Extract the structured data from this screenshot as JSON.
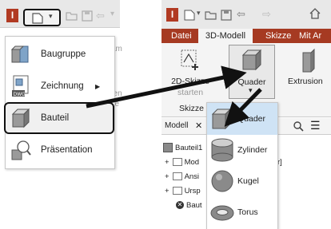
{
  "left_window": {
    "app_letter": "I",
    "bg_labels": [
      "sam",
      "nen",
      "ue"
    ],
    "menu": [
      {
        "label": "Baugruppe",
        "icon": "assembly-icon"
      },
      {
        "label": "Zeichnung",
        "icon": "drawing-icon",
        "submenu": true,
        "badge": "DWG"
      },
      {
        "label": "Bauteil",
        "icon": "part-icon",
        "highlighted": true
      },
      {
        "label": "Präsentation",
        "icon": "presentation-icon"
      }
    ]
  },
  "right_window": {
    "app_letter": "I",
    "tabs": [
      "Datei",
      "3D-Modell",
      "Skizze",
      "Mit Ar"
    ],
    "active_tab": "3D-Modell",
    "ribbon": {
      "sketch_button": "2D-Skizze",
      "sketch_sub": "starten",
      "primitive_button": "Quader",
      "extrude_button": "Extrusion",
      "group_label": "Skizze",
      "group_label_2": "r"
    },
    "model_panel": {
      "tab_label": "Modell",
      "close": "✕",
      "tree": [
        {
          "label": "Bauteil1"
        },
        {
          "label": "Mod",
          "trail": "r]"
        },
        {
          "label": "Ansi"
        },
        {
          "label": "Ursp"
        },
        {
          "label": "Baut"
        }
      ]
    },
    "dropdown": [
      {
        "label": "Quader",
        "icon": "box-icon"
      },
      {
        "label": "Zylinder",
        "icon": "cylinder-icon"
      },
      {
        "label": "Kugel",
        "icon": "sphere-icon"
      },
      {
        "label": "Torus",
        "icon": "torus-icon"
      }
    ]
  },
  "colors": {
    "tab_bar": "#a63a22",
    "highlight_border": "#111111",
    "arrow": "#111111",
    "selection": "#cfe3f5"
  }
}
